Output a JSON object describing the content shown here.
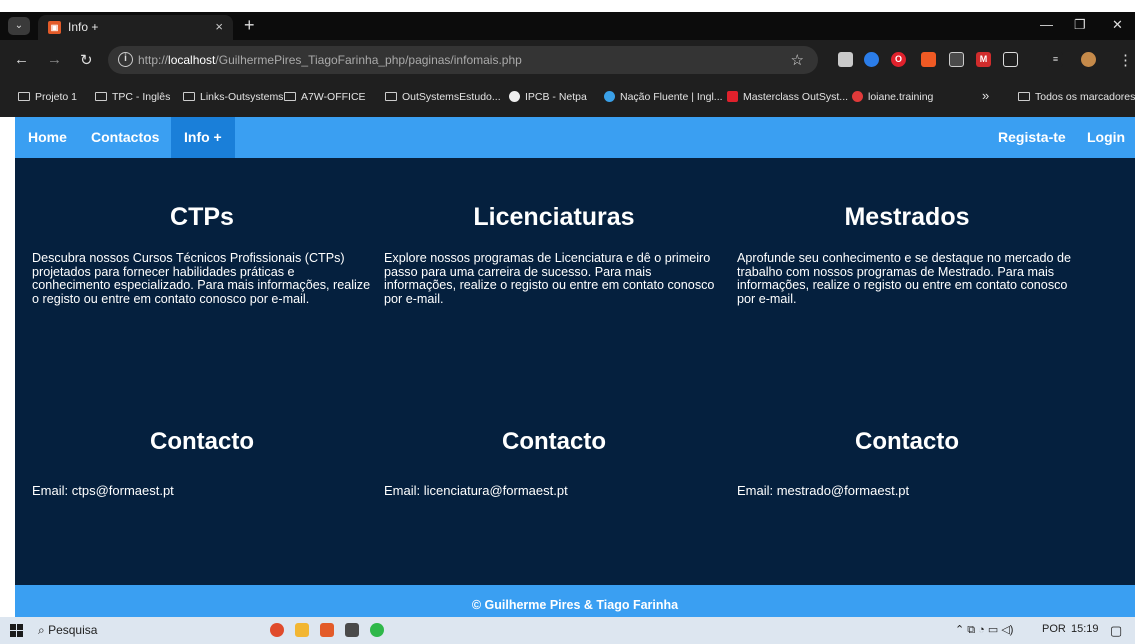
{
  "browser": {
    "tab_title": "Info +",
    "tab_close": "×",
    "tab_new": "+",
    "url_prefix": "http://",
    "url_host": "localhost",
    "url_path": "/GuilhermePires_TiagoFarinha_php/paginas/infomais.php",
    "bookmarks": [
      "Projeto 1",
      "TPC - Inglês",
      "Links-Outsystems",
      "A7W-OFFICE",
      "OutSystemsEstudo...",
      "IPCB - Netpa",
      "Nação Fluente | Ingl...",
      "Masterclass OutSyst...",
      "loiane.training"
    ],
    "bookmarks_more": "»",
    "all_bookmarks": "Todos os marcadores"
  },
  "navbar": {
    "home": "Home",
    "contactos": "Contactos",
    "info": "Info +",
    "registar": "Regista-te",
    "login": "Login"
  },
  "columns": [
    {
      "title": "CTPs",
      "text": "Descubra nossos Cursos Técnicos Profissionais (CTPs) projetados para fornecer habilidades práticas e conhecimento especializado. Para mais informações, realize o registo ou entre em contato conosco por e-mail.",
      "contact_title": "Contacto",
      "email": "Email: ctps@formaest.pt"
    },
    {
      "title": "Licenciaturas",
      "text": "Explore nossos programas de Licenciatura e dê o primeiro passo para uma carreira de sucesso. Para mais informações, realize o registo ou entre em contato conosco por e-mail.",
      "contact_title": "Contacto",
      "email": "Email: licenciatura@formaest.pt"
    },
    {
      "title": "Mestrados",
      "text": "Aprofunde seu conhecimento e se destaque no mercado de trabalho com nossos programas de Mestrado. Para mais informações, realize o registo ou entre em contato conosco por e-mail.",
      "contact_title": "Contacto",
      "email": "Email: mestrado@formaest.pt"
    }
  ],
  "footer": {
    "text": "© Guilherme Pires & Tiago Farinha"
  },
  "taskbar": {
    "search": "Pesquisa",
    "language": "POR",
    "time": "15:19"
  }
}
